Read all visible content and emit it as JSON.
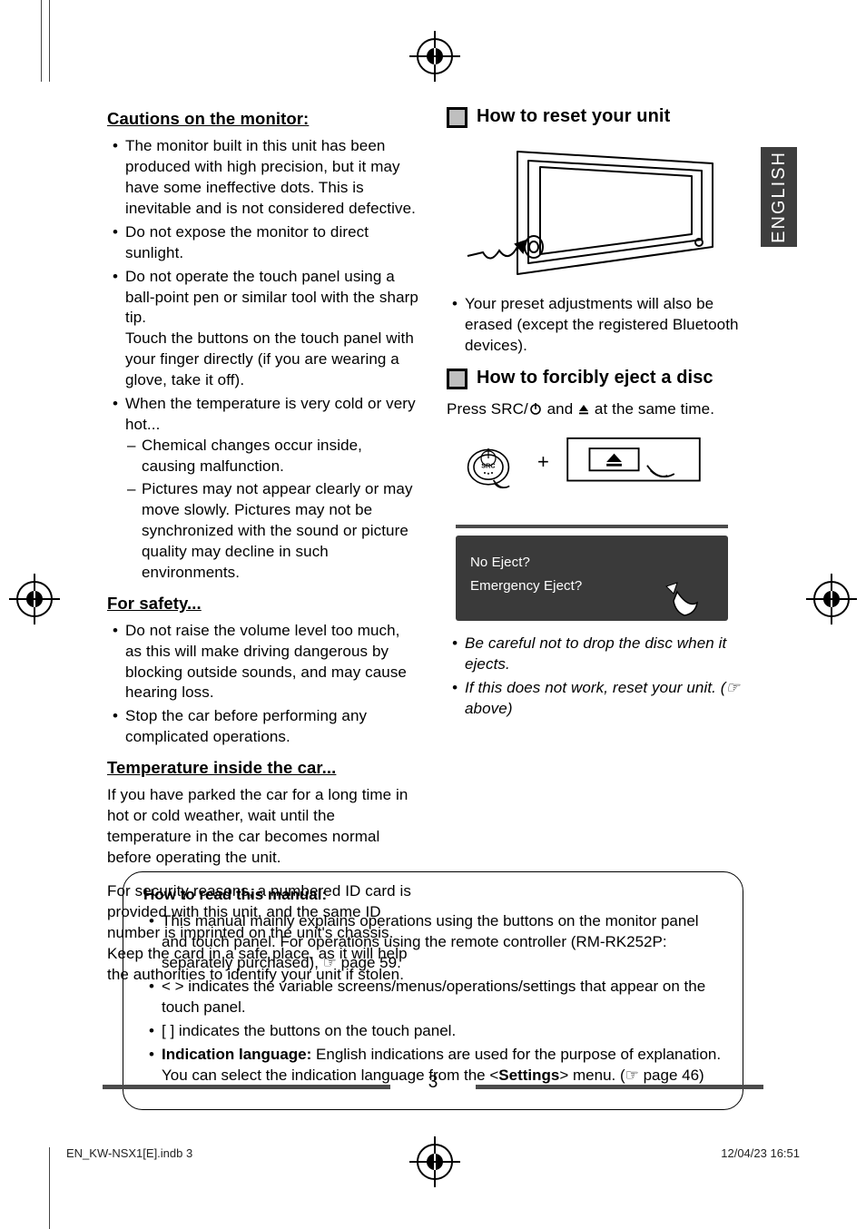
{
  "side_tab": "ENGLISH",
  "left": {
    "h_cautions": "Cautions on the monitor:",
    "cautions": [
      "The monitor built in this unit has been produced with high precision, but it may have some ineffective dots. This is inevitable and is not considered defective.",
      "Do not expose the monitor to direct sunlight.",
      "Do not operate the touch panel using a ball-point pen or similar tool with the sharp tip.\nTouch the buttons on the touch panel with your finger directly (if you are wearing a glove, take it off).",
      "When the temperature is very cold or very hot..."
    ],
    "cautions_sub": [
      "Chemical changes occur inside, causing malfunction.",
      "Pictures may not appear clearly or may move slowly. Pictures may not be synchronized with the sound or picture quality may decline in such environments."
    ],
    "h_safety": "For safety...",
    "safety": [
      "Do not raise the volume level too much, as this will make driving dangerous by blocking outside sounds, and may cause hearing loss.",
      "Stop the car before performing any complicated operations."
    ],
    "h_temp": "Temperature inside the car...",
    "temp_para": "If you have parked the car for a long time in hot or cold weather, wait until the temperature in the car becomes normal before operating the unit.",
    "security_para": "For security reasons, a numbered ID card is provided with this unit, and the same ID number is imprinted on the unit's chassis. Keep the card in a safe place, as it will help the authorities to identify your unit if stolen."
  },
  "right": {
    "h_reset": "How to reset your unit",
    "reset_note": "Your preset adjustments will also be erased (except the registered Bluetooth devices).",
    "h_eject": "How to forcibly eject a disc",
    "eject_press_prefix": "Press SRC/",
    "eject_press_mid": " and ",
    "eject_press_suffix": " at the same time.",
    "panel_line1": "No Eject?",
    "panel_line2": "Emergency Eject?",
    "eject_notes": [
      "Be careful not to drop the disc when it ejects.",
      "If this does not work, reset your unit. (☞ above)"
    ],
    "src_label": "SRC"
  },
  "info_box": {
    "heading": "How to read this manual:",
    "items": [
      "This manual mainly explains operations using the buttons on the monitor panel and touch panel. For operations using the remote controller (RM-RK252P: separately purchased), ☞ page 59.",
      "< > indicates the variable screens/menus/operations/settings that appear on the touch panel.",
      "[ ] indicates the buttons on the touch panel."
    ],
    "indication_prefix": "Indication language:",
    "indication_body": " English indications are used for the purpose of explanation. You can select the indication language from the <",
    "indication_bold": "Settings",
    "indication_after": "> menu. (☞ page 46)"
  },
  "page_number": "3",
  "footer_left": "EN_KW-NSX1[E].indb   3",
  "footer_right": "12/04/23   16:51"
}
